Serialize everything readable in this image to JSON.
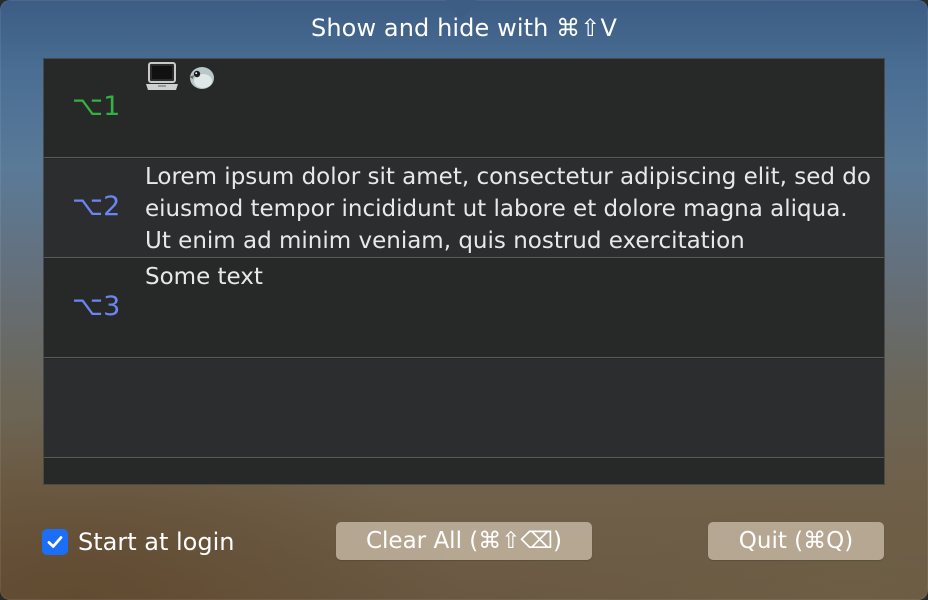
{
  "window": {
    "title": "Show and hide with ⌘⇧V"
  },
  "colors": {
    "key_pinned": "#33b240",
    "key_default": "#6b86f2",
    "checkbox_accent": "#1b6ef5"
  },
  "history": [
    {
      "key": "⌥1",
      "type": "image",
      "icons": [
        "laptop-icon",
        "bird-icon"
      ],
      "text": ""
    },
    {
      "key": "⌥2",
      "type": "text",
      "text": "Lorem ipsum dolor sit amet, consectetur adipiscing elit, sed do eiusmod tempor incididunt ut labore et dolore magna aliqua. Ut enim ad minim veniam, quis nostrud exercitation"
    },
    {
      "key": "⌥3",
      "type": "text",
      "text": "Some text"
    }
  ],
  "footer": {
    "start_at_login_label": "Start at login",
    "start_at_login_checked": true,
    "clear_all_label": "Clear All (⌘⇧⌫)",
    "quit_label": "Quit (⌘Q)"
  }
}
